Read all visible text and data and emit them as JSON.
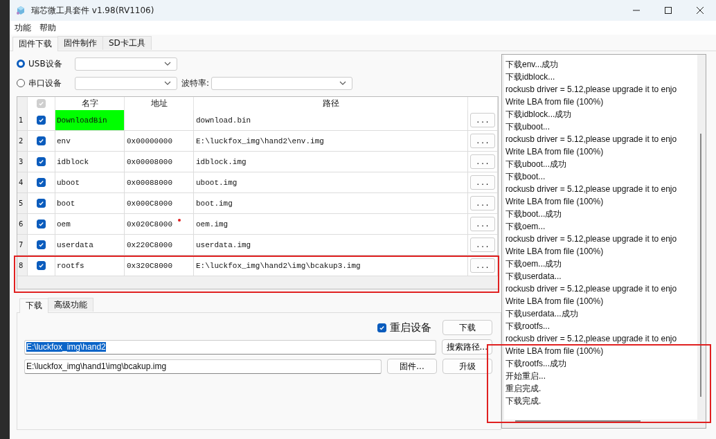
{
  "window": {
    "title": "瑞芯微工具套件 v1.98(RV1106)"
  },
  "menu": [
    "功能",
    "帮助"
  ],
  "tabs": [
    {
      "label": "固件下载",
      "selected": true
    },
    {
      "label": "固件制作",
      "selected": false
    },
    {
      "label": "SD卡工具",
      "selected": false
    }
  ],
  "connection": {
    "options": [
      {
        "label": "USB设备",
        "selected": true
      },
      {
        "label": "串口设备",
        "selected": false
      }
    ],
    "baud_label": "波特率:"
  },
  "table": {
    "header_checked": true,
    "columns": [
      "名字",
      "地址",
      "路径"
    ],
    "rows": [
      {
        "index": "1",
        "checked": true,
        "name": "DownloadBin",
        "highlighted": true,
        "address": "",
        "path": "download.bin",
        "browse": "..."
      },
      {
        "index": "2",
        "checked": true,
        "name": "env",
        "highlighted": false,
        "address": "0x00000000",
        "path": "E:\\luckfox_img\\hand2\\env.img",
        "browse": "..."
      },
      {
        "index": "3",
        "checked": true,
        "name": "idblock",
        "highlighted": false,
        "address": "0x00008000",
        "path": "idblock.img",
        "browse": "..."
      },
      {
        "index": "4",
        "checked": true,
        "name": "uboot",
        "highlighted": false,
        "address": "0x00088000",
        "path": "uboot.img",
        "browse": "..."
      },
      {
        "index": "5",
        "checked": true,
        "name": "boot",
        "highlighted": false,
        "address": "0x000C8000",
        "path": "boot.img",
        "browse": "..."
      },
      {
        "index": "6",
        "checked": true,
        "name": "oem",
        "highlighted": false,
        "address": "0x020C8000",
        "path": "oem.img",
        "browse": "..."
      },
      {
        "index": "7",
        "checked": true,
        "name": "userdata",
        "highlighted": false,
        "address": "0x220C8000",
        "path": "userdata.img",
        "browse": "..."
      },
      {
        "index": "8",
        "checked": true,
        "name": "rootfs",
        "highlighted": false,
        "address": "0x320C8000",
        "path": "E:\\luckfox_img\\hand2\\img\\bcakup3.img",
        "browse": "..."
      }
    ]
  },
  "bottom_tabs": [
    {
      "label": "下载",
      "selected": true
    },
    {
      "label": "高级功能",
      "selected": false
    }
  ],
  "reboot": {
    "label": "重启设备",
    "checked": true
  },
  "download_button": "下载",
  "path_field": {
    "value": "E:\\luckfox_img\\hand2",
    "value_selected": true
  },
  "search_button": "搜索路径...",
  "firmware_field": {
    "value": "E:\\luckfox_img\\hand1\\img\\bcakup.img"
  },
  "firmware_button": "固件...",
  "upgrade_button": "升级",
  "log": [
    "下载env...成功",
    "下载idblock...",
    "rockusb driver = 5.12,please upgrade it to enjo",
    "Write LBA from file (100%)",
    "下载idblock...成功",
    "下载uboot...",
    "rockusb driver = 5.12,please upgrade it to enjo",
    "Write LBA from file (100%)",
    "下载uboot...成功",
    "下载boot...",
    "rockusb driver = 5.12,please upgrade it to enjo",
    "Write LBA from file (100%)",
    "下载boot...成功",
    "下载oem...",
    "rockusb driver = 5.12,please upgrade it to enjo",
    "Write LBA from file (100%)",
    "下载oem...成功",
    "下载userdata...",
    "rockusb driver = 5.12,please upgrade it to enjo",
    "Write LBA from file (100%)",
    "下载userdata...成功",
    "下载rootfs...",
    "rockusb driver = 5.12,please upgrade it to enjo",
    "Write LBA from file (100%)",
    "下载rootfs...成功",
    "开始重启...",
    "重启完成.",
    "下载完成."
  ]
}
